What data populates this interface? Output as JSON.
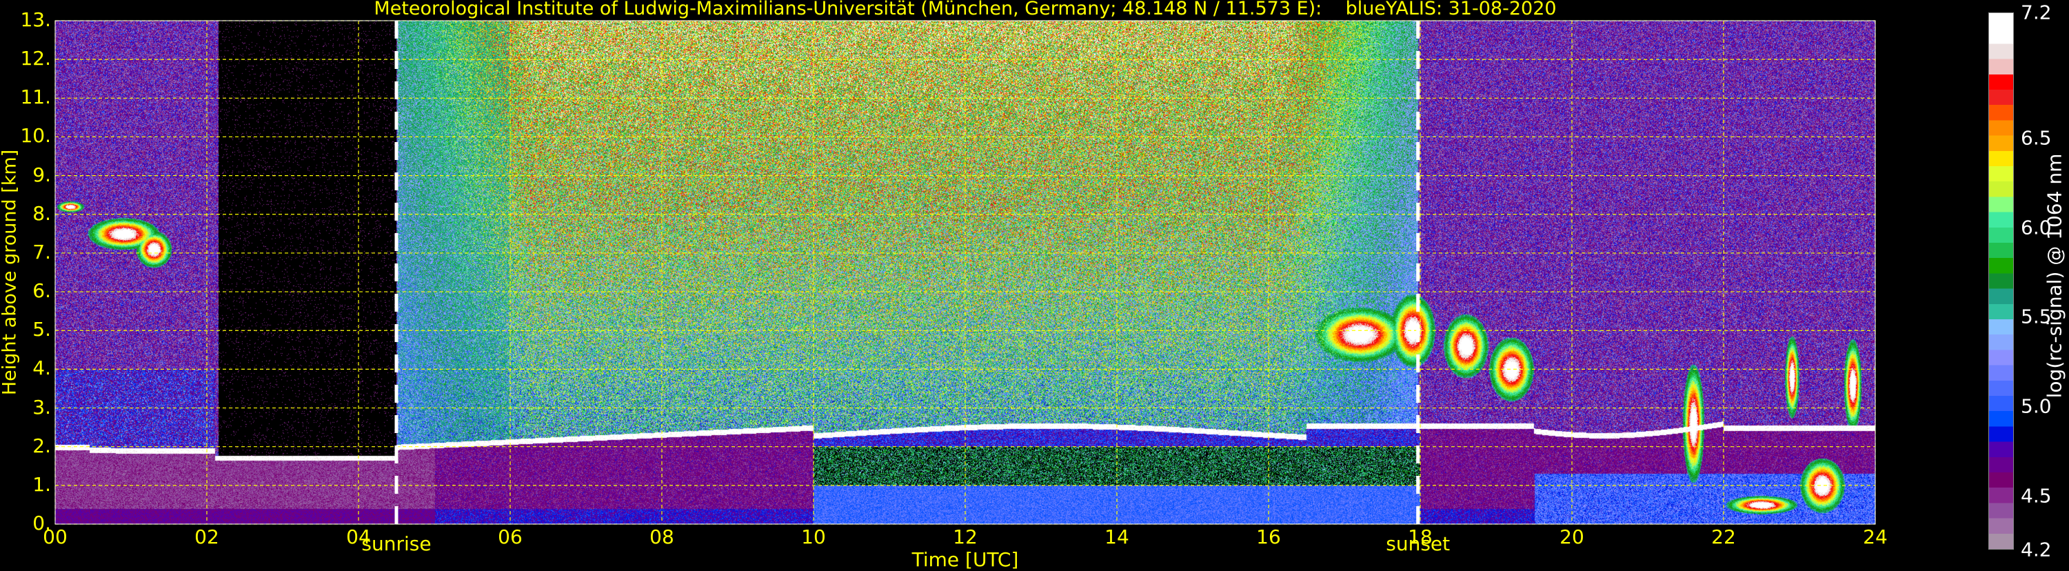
{
  "chart_data": {
    "type": "heatmap",
    "title": "Meteorological Institute of Ludwig-Maximilians-Universität (München, Germany; 48.148 N / 11.573 E):    blueYALIS: 31-08-2020",
    "xlabel": "Time [UTC]",
    "ylabel": "Height above ground [km]",
    "xlim": [
      0,
      24
    ],
    "ylim": [
      0,
      13
    ],
    "xticks": [
      "00",
      "02",
      "04",
      "06",
      "08",
      "10",
      "12",
      "14",
      "16",
      "18",
      "20",
      "22",
      "24"
    ],
    "xtick_values": [
      0,
      2,
      4,
      6,
      8,
      10,
      12,
      14,
      16,
      18,
      20,
      22,
      24
    ],
    "yticks": [
      "0.",
      "1.",
      "2.",
      "3.",
      "4.",
      "5.",
      "6.",
      "7.",
      "8.",
      "9.",
      "10.",
      "11.",
      "12.",
      "13."
    ],
    "ytick_values": [
      0,
      1,
      2,
      3,
      4,
      5,
      6,
      7,
      8,
      9,
      10,
      11,
      12,
      13
    ],
    "grid": true,
    "grid_color": "#ffff00",
    "background": "#000000",
    "annotations": [
      {
        "label": "sunrise",
        "x": 4.5
      },
      {
        "label": "sunset",
        "x": 17.97
      }
    ],
    "colorbar": {
      "label": "log(rc-signal) @ 1064 nm",
      "range": [
        4.2,
        7.2
      ],
      "ticks": [
        "4.2",
        "4.5",
        "5.0",
        "5.5",
        "6.0",
        "6.5",
        "7.2"
      ],
      "tick_values": [
        4.2,
        4.5,
        5.0,
        5.5,
        6.0,
        6.5,
        7.2
      ],
      "colors_bottom_to_top": [
        "#a890a8",
        "#a070a8",
        "#9050a0",
        "#882890",
        "#780070",
        "#680090",
        "#5000b0",
        "#0010e0",
        "#0050ff",
        "#3060ff",
        "#5070ff",
        "#7080ff",
        "#8c90ff",
        "#88a8ff",
        "#88c0ff",
        "#30c0a0",
        "#20a088",
        "#109030",
        "#18a800",
        "#20c050",
        "#30d880",
        "#40eaa0",
        "#88ff80",
        "#ccf530",
        "#e0ff30",
        "#ffe600",
        "#ffaa00",
        "#ff8c00",
        "#ff5500",
        "#f02020",
        "#ff0000",
        "#f0c0c0",
        "#ede0e0",
        "#ffffff",
        "#ffffff"
      ]
    }
  }
}
